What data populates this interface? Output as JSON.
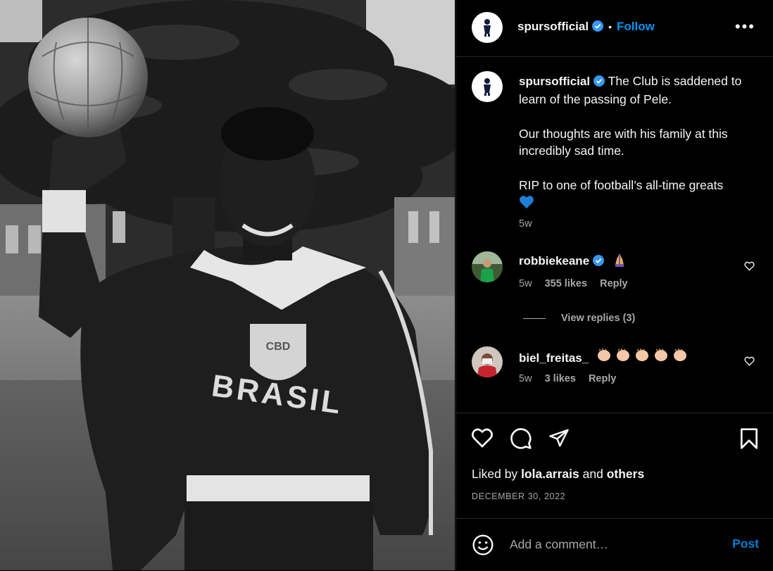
{
  "post": {
    "username": "spursofficial",
    "follow_label": "Follow",
    "dot": "•",
    "more_label": "•••",
    "caption": {
      "line1": "The Club is saddened to learn of the passing of Pele.",
      "line2": "Our thoughts are with his family at this incredibly sad time.",
      "line3": "RIP to one of football’s all-time greats",
      "age": "5w"
    },
    "photo": {
      "shirt_text": "BRASIL",
      "crest_text": "CBD"
    }
  },
  "comments": [
    {
      "username": "robbiekeane",
      "age": "5w",
      "likes": "355 likes",
      "reply": "Reply"
    },
    {
      "username": "biel_freitas_",
      "age": "5w",
      "likes": "3 likes",
      "reply": "Reply"
    }
  ],
  "view_replies": "View replies (3)",
  "likes": {
    "prefix": "Liked by",
    "user": "lola.arrais",
    "and": "and",
    "others": "others"
  },
  "date": "DECEMBER 30, 2022",
  "add_comment": {
    "placeholder": "Add a comment…",
    "post_label": "Post"
  },
  "colors": {
    "accent": "#0095f6",
    "verified": "#3897f0",
    "heart_emoji": "#1f7fd6"
  }
}
